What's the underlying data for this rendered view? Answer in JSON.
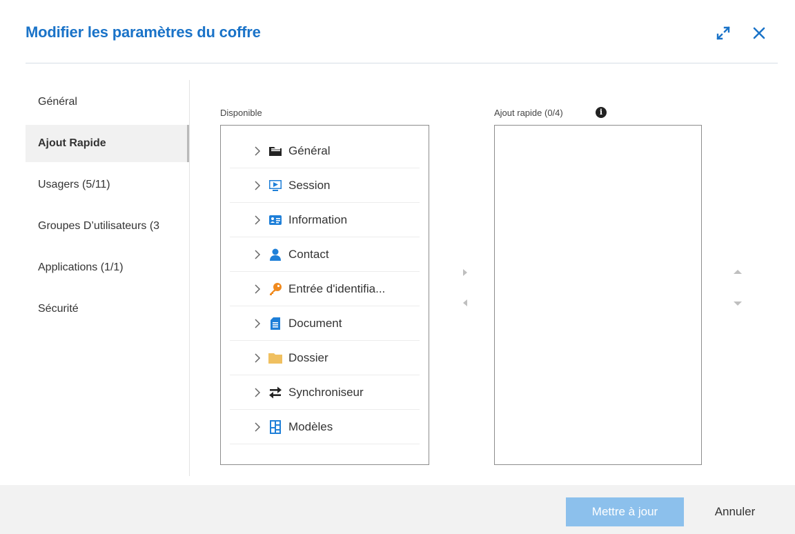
{
  "dialog": {
    "title": "Modifier les paramètres du coffre",
    "expand_icon": "expand-icon",
    "close_icon": "close-icon"
  },
  "nav": {
    "items": [
      {
        "label": "Général",
        "active": false
      },
      {
        "label": "Ajout Rapide",
        "active": true
      },
      {
        "label": "Usagers (5/11)",
        "active": false
      },
      {
        "label": "Groupes D’utilisateurs (3",
        "active": false
      },
      {
        "label": "Applications (1/1)",
        "active": false
      },
      {
        "label": "Sécurité",
        "active": false
      }
    ]
  },
  "available": {
    "label": "Disponible",
    "items": [
      {
        "label": "Général",
        "icon": "folder-icon",
        "color": "#222222"
      },
      {
        "label": "Session",
        "icon": "session-icon",
        "color": "#1e7fd8"
      },
      {
        "label": "Information",
        "icon": "id-card-icon",
        "color": "#1e7fd8"
      },
      {
        "label": "Contact",
        "icon": "contact-icon",
        "color": "#1e7fd8"
      },
      {
        "label": "Entrée d'identifia...",
        "icon": "key-icon",
        "color": "#f08a1e"
      },
      {
        "label": "Document",
        "icon": "document-icon",
        "color": "#1e7fd8"
      },
      {
        "label": "Dossier",
        "icon": "folder-yellow-icon",
        "color": "#f0c060"
      },
      {
        "label": "Synchroniseur",
        "icon": "sync-icon",
        "color": "#222222"
      },
      {
        "label": "Modèles",
        "icon": "templates-icon",
        "color": "#1e7fd8"
      }
    ]
  },
  "quick_add": {
    "label": "Ajout rapide (0/4)",
    "info_icon": "info-icon",
    "info_glyph": "i",
    "items": []
  },
  "footer": {
    "update_label": "Mettre à jour",
    "cancel_label": "Annuler"
  },
  "colors": {
    "accent": "#1a73c8",
    "update_button": "#8cc0ec",
    "footer_bg": "#f2f2f2"
  }
}
